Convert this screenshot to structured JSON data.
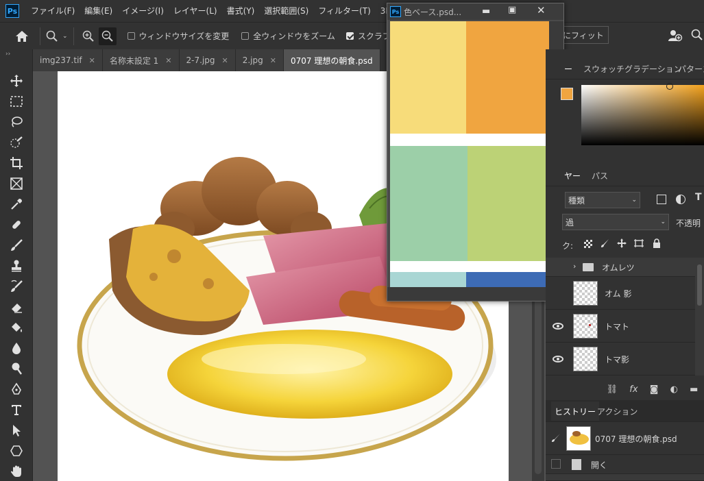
{
  "app": {
    "logo": "Ps",
    "accent": "#31a8ff"
  },
  "menu": [
    "ファイル(F)",
    "編集(E)",
    "イメージ(I)",
    "レイヤー(L)",
    "書式(Y)",
    "選択範囲(S)",
    "フィルター(T)",
    "3D(D)"
  ],
  "options": {
    "resize_window": "ウィンドウサイズを変更",
    "zoom_all": "全ウィンドウをズーム",
    "scrubby": "スクラブ",
    "fit_screen": "画面にフィット"
  },
  "tabs": [
    {
      "label": "img237.tif"
    },
    {
      "label": "名称未設定 1"
    },
    {
      "label": "2-7.jpg"
    },
    {
      "label": "2.jpg"
    },
    {
      "label": "0707 理想の朝食.psd"
    }
  ],
  "float_window": {
    "title": "色ベース.psd..."
  },
  "panels": {
    "color_tabs": [
      "ー",
      "スウォッチ",
      "グラデーション",
      "パターン"
    ],
    "layer_tabs": [
      "ヤー",
      "パス"
    ],
    "filter_kind": "種類",
    "blend_mode": "過",
    "opacity_label": "不透明",
    "lock_label": "ク:",
    "layers": [
      {
        "name": "オムレツ",
        "type": "group"
      },
      {
        "name": "オム 影"
      },
      {
        "name": "トマト"
      },
      {
        "name": "トマ影"
      }
    ],
    "history_tabs": [
      "ヒストリー",
      "アクション"
    ],
    "history_snapshot": "0707 理想の朝食.psd",
    "history_items": [
      "開く"
    ]
  },
  "colors": {
    "swatch_yellow": "#f7dc7a",
    "swatch_orange": "#f0a540",
    "swatch_mint": "#9ccfa8",
    "swatch_lime": "#bcd276",
    "swatch_aqua": "#a9d6d4",
    "swatch_blue": "#3d6bb5"
  }
}
